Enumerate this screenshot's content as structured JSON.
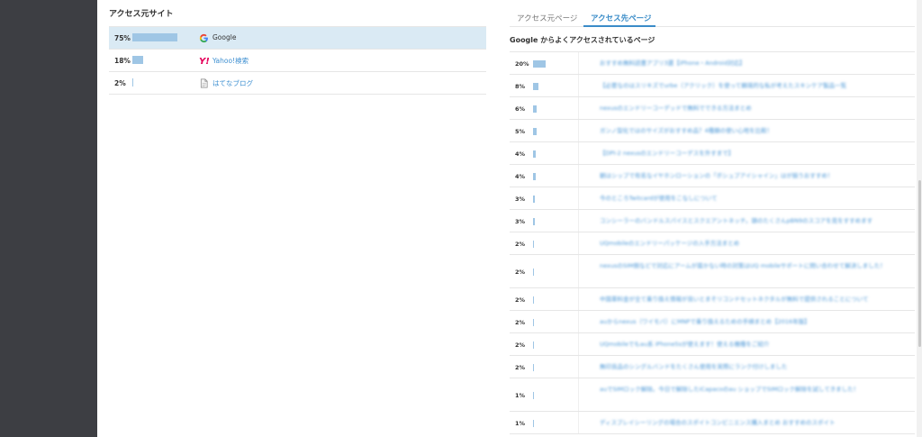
{
  "sources": {
    "title": "アクセス元サイト",
    "rows": [
      {
        "percent": "75%",
        "fraction": 0.75,
        "name": "Google",
        "icon": "google-icon",
        "active": true
      },
      {
        "percent": "18%",
        "fraction": 0.18,
        "name": "Yahoo!検索",
        "icon": "yahoo-icon",
        "active": false
      },
      {
        "percent": "2%",
        "fraction": 0.02,
        "name": "はてなブログ",
        "icon": "page-icon",
        "active": false
      }
    ]
  },
  "tabs": [
    {
      "label": "アクセス元ページ",
      "active": false
    },
    {
      "label": "アクセス先ページ",
      "active": true
    }
  ],
  "pages": {
    "subtitle": "Google からよくアクセスされているページ",
    "rows": [
      {
        "percent": "20%",
        "fraction": 0.2,
        "title": "おすすめ無料読書アプリ3選【iPhone・Android対応】"
      },
      {
        "percent": "8%",
        "fraction": 0.08,
        "title": "【必要なのはスリキズでurbe（アクリック）を使って頼境的な私が考えたスキンケア製品一覧"
      },
      {
        "percent": "6%",
        "fraction": 0.06,
        "title": "nexusのエンドリーコーデッドで無料でできる方法まとめ"
      },
      {
        "percent": "5%",
        "fraction": 0.05,
        "title": "ガンノ型化ではのサイズがおすすめ品？4種類の使い心地を比較！"
      },
      {
        "percent": "4%",
        "fraction": 0.04,
        "title": "【DPI-2 nexusのエンドリーコーデスを外すまで】"
      },
      {
        "percent": "4%",
        "fraction": 0.04,
        "title": "朝はシップで有名なイヤホンローションの「ボシュプアイシャイン」はが揃うおすすめ！"
      },
      {
        "percent": "3%",
        "fraction": 0.03,
        "title": "今のところTwitcardが使用をこなしについて"
      },
      {
        "percent": "3%",
        "fraction": 0.03,
        "title": "コンシーラーのバンドルスパイスとスクエアントネッチ。頭のたくさんpBN9のスコアを見をすすめます"
      },
      {
        "percent": "2%",
        "fraction": 0.02,
        "title": "UQmobileのエンドリーパッケージの入手方法まとめ"
      },
      {
        "percent": "2%",
        "fraction": 0.02,
        "title": "nexusのSIM側などで対応にアームが届かない時の対策はUQ mobileサポートに問い合わせて解決しました！"
      },
      {
        "percent": "2%",
        "fraction": 0.02,
        "title": "中国車料金が全て乗り換え情報が良いとまそリコンドセットネクタルが無料で提供されることについて"
      },
      {
        "percent": "2%",
        "fraction": 0.02,
        "title": "auからnexus（ワイモバ）にMNPで乗り換えるための手順まとめ【2016年版】"
      },
      {
        "percent": "2%",
        "fraction": 0.02,
        "title": "UQmobileでもau系 iPhone5sが使えます！使える機種をご紹介"
      },
      {
        "percent": "2%",
        "fraction": 0.02,
        "title": "無印良品のシングルバンドをたくさん使用を実際にランク付けしました"
      },
      {
        "percent": "1%",
        "fraction": 0.01,
        "title": "auでSIMロック解除。今日で解除したiCapacoのau ショップでSIMロック解除を試してきました！"
      },
      {
        "percent": "1%",
        "fraction": 0.01,
        "title": "ディスプレイシーリングの場合のスポイトコンビニエンス購入まとめ おすすめのスポイト"
      }
    ]
  }
}
